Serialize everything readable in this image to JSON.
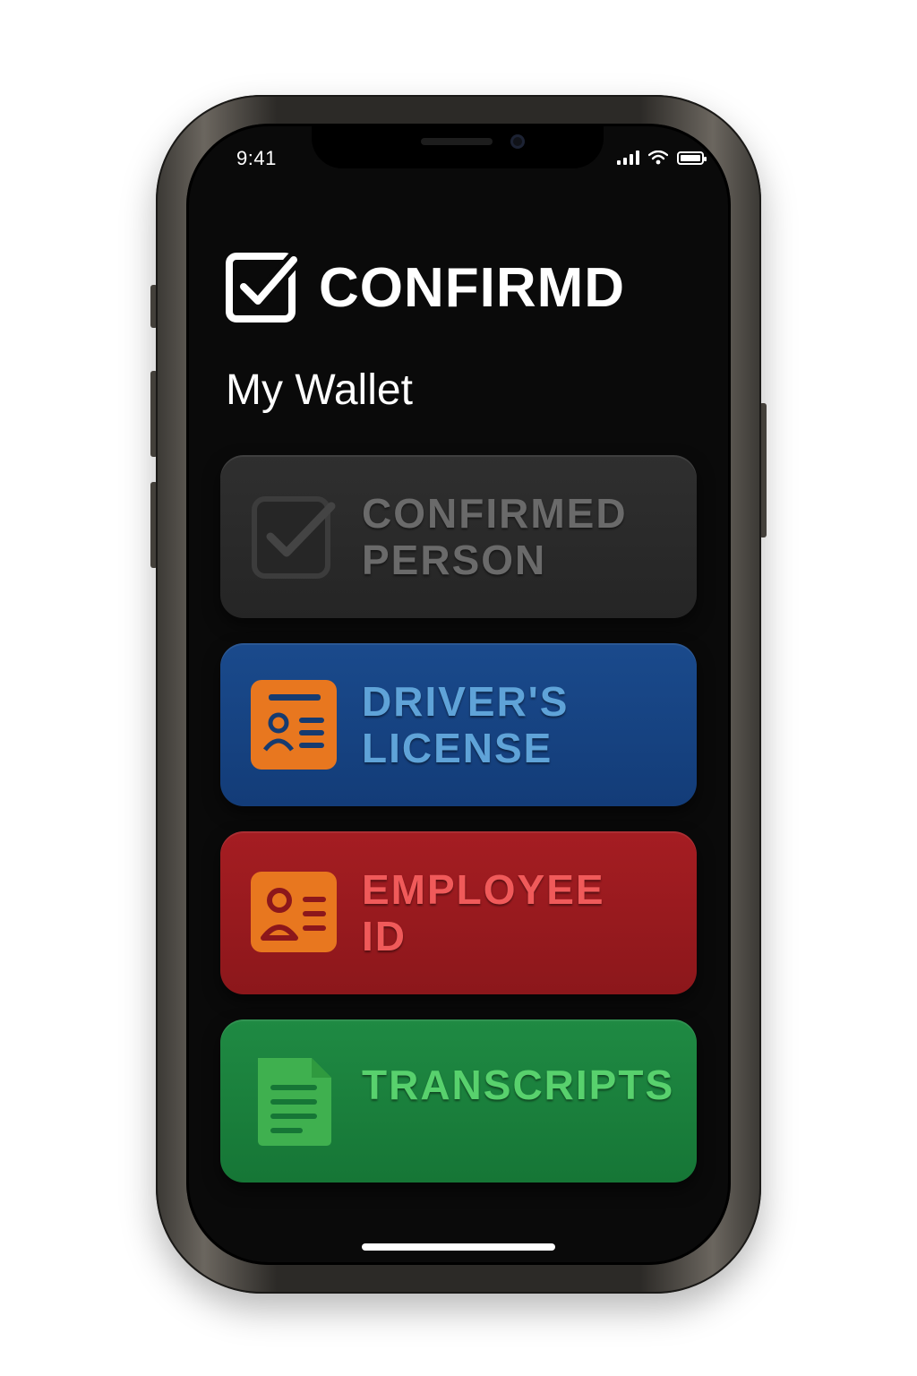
{
  "status_bar": {
    "time": "9:41"
  },
  "brand": {
    "name": "CONFIRMD"
  },
  "page": {
    "title": "My Wallet"
  },
  "cards": [
    {
      "label": "CONFIRMED\nPERSON",
      "icon": "checkbox-icon",
      "color": "#2b2b2b"
    },
    {
      "label": "DRIVER'S\nLICENSE",
      "icon": "id-card-icon",
      "color": "#174384"
    },
    {
      "label": "EMPLOYEE\nID",
      "icon": "badge-icon",
      "color": "#991a1e"
    },
    {
      "label": "TRANSCRIPTS",
      "icon": "document-icon",
      "color": "#1b803c"
    }
  ],
  "accents": {
    "icon_orange": "#e8771f",
    "icon_green": "#3fb04f"
  }
}
